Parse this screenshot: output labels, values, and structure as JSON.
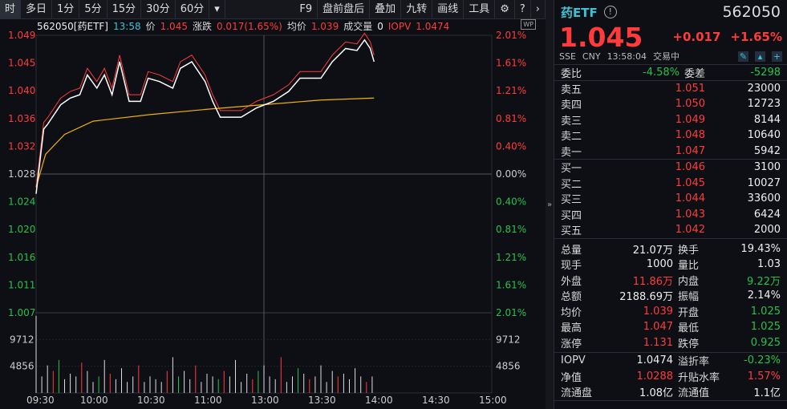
{
  "toolbar": {
    "items": [
      "时",
      "多日",
      "1分",
      "5分",
      "15分",
      "30分",
      "60分",
      "▾"
    ],
    "right": [
      "F9",
      "盘前盘后",
      "叠加",
      "九转",
      "画线",
      "工具"
    ],
    "gear": "gear-icon",
    "help": "help-icon",
    "next": "›"
  },
  "info": {
    "code": "562050[药ETF]",
    "time": "13:58",
    "price_label": "价",
    "price": "1.045",
    "chg_label": "涨跌",
    "chg": "0.017(1.65%)",
    "avg_label": "均价",
    "avg": "1.039",
    "vol_label": "成交量",
    "vol": "0",
    "iopv_label": "IOPV",
    "iopv": "1.0474",
    "wp": "WP"
  },
  "chart_data": {
    "type": "line",
    "title": "562050 药ETF 分时",
    "prev_close": 1.028,
    "ylim": [
      1.007,
      1.049
    ],
    "y_ticks_left": [
      "1.049",
      "1.045",
      "1.040",
      "1.036",
      "1.032",
      "1.028",
      "1.024",
      "1.020",
      "1.016",
      "1.011",
      "1.007"
    ],
    "y_ticks_right": [
      "2.01%",
      "1.61%",
      "1.21%",
      "0.81%",
      "0.40%",
      "0.00%",
      "0.40%",
      "0.81%",
      "1.21%",
      "1.61%",
      "2.01%"
    ],
    "vol_ticks": [
      "9712",
      "4856"
    ],
    "vol_max": 14568,
    "x_ticks": [
      "09:30",
      "10:00",
      "10:30",
      "11:00",
      "13:00",
      "13:30",
      "14:00",
      "14:30",
      "15:00"
    ],
    "price_series": {
      "name": "价格",
      "minutes": [
        0,
        4,
        6,
        13,
        18,
        23,
        27,
        32,
        36,
        40,
        44,
        49,
        55,
        59,
        65,
        72,
        76,
        82,
        89,
        93,
        97,
        108,
        116,
        125,
        133,
        139,
        150,
        156,
        163,
        169,
        173,
        176,
        178
      ],
      "values": [
        1.025,
        1.0348,
        1.0355,
        1.0385,
        1.0395,
        1.04,
        1.043,
        1.041,
        1.043,
        1.04,
        1.045,
        1.039,
        1.039,
        1.0425,
        1.042,
        1.041,
        1.044,
        1.045,
        1.042,
        1.039,
        1.0366,
        1.0366,
        1.038,
        1.039,
        1.0405,
        1.0425,
        1.0425,
        1.045,
        1.047,
        1.0467,
        1.0483,
        1.047,
        1.045
      ]
    },
    "avg_series": {
      "name": "均价",
      "minutes": [
        0,
        5,
        15,
        30,
        60,
        90,
        120,
        150,
        178
      ],
      "values": [
        1.026,
        1.031,
        1.034,
        1.036,
        1.037,
        1.0378,
        1.0385,
        1.0392,
        1.0395
      ]
    },
    "iopv_series": {
      "name": "IOPV",
      "offset": 0.001
    },
    "volume": [
      14000,
      3000,
      5000,
      4000,
      6000,
      2500,
      3500,
      3000,
      5500,
      4000,
      2000,
      3000,
      6000,
      3500,
      2500,
      4500,
      2000,
      3000,
      5000,
      2000,
      3000,
      2500,
      2000,
      4000,
      6500,
      3000,
      4000,
      2500,
      5000,
      2000,
      3500,
      3000,
      2500,
      4000,
      3000,
      6000,
      2000,
      3500,
      2500,
      4000,
      5000,
      3000,
      2500,
      6500,
      2000,
      3000,
      4500,
      3500,
      2500,
      3000,
      5000,
      2000,
      4000,
      3000,
      3500,
      2500,
      4500,
      3000,
      2000,
      3000
    ]
  },
  "quote": {
    "name": "药ETF",
    "code": "562050",
    "price": "1.045",
    "chg": "+0.017",
    "pct": "+1.65%",
    "exchange": "SSE",
    "currency": "CNY",
    "time": "13:58:04",
    "status": "交易中",
    "wb_label": "委比",
    "wb": "-4.58%",
    "wc_label": "委差",
    "wc": "-5298",
    "asks": [
      {
        "l": "卖五",
        "p": "1.051",
        "v": "23000"
      },
      {
        "l": "卖四",
        "p": "1.050",
        "v": "12723"
      },
      {
        "l": "卖三",
        "p": "1.049",
        "v": "8144"
      },
      {
        "l": "卖二",
        "p": "1.048",
        "v": "10640"
      },
      {
        "l": "卖一",
        "p": "1.047",
        "v": "5942"
      }
    ],
    "bids": [
      {
        "l": "买一",
        "p": "1.046",
        "v": "3100"
      },
      {
        "l": "买二",
        "p": "1.045",
        "v": "10027"
      },
      {
        "l": "买三",
        "p": "1.044",
        "v": "33600"
      },
      {
        "l": "买四",
        "p": "1.043",
        "v": "6424"
      },
      {
        "l": "买五",
        "p": "1.042",
        "v": "2000"
      }
    ],
    "stats": [
      [
        "总量",
        "21.07万",
        "white",
        "换手",
        "19.43%",
        "white"
      ],
      [
        "现手",
        "1000",
        "white",
        "量比",
        "1.03",
        "white"
      ],
      [
        "外盘",
        "11.86万",
        "red",
        "内盘",
        "9.22万",
        "green"
      ],
      [
        "总额",
        "2188.69万",
        "white",
        "振幅",
        "2.14%",
        "white"
      ],
      [
        "均价",
        "1.039",
        "red",
        "开盘",
        "1.025",
        "green"
      ],
      [
        "最高",
        "1.047",
        "red",
        "最低",
        "1.025",
        "green"
      ],
      [
        "涨停",
        "1.131",
        "red",
        "跌停",
        "0.925",
        "green"
      ]
    ],
    "etf": [
      [
        "IOPV",
        "1.0474",
        "white",
        "溢折率",
        "-0.23%",
        "green"
      ],
      [
        "净值",
        "1.0288",
        "red",
        "升贴水率",
        "1.57%",
        "red"
      ],
      [
        "流通盘",
        "1.08亿",
        "white",
        "流通值",
        "1.1亿",
        "white"
      ]
    ]
  },
  "colors": {
    "up": "#ff3b3b",
    "down": "#27c24c",
    "avg": "#f0b400",
    "price": "#ffffff"
  }
}
